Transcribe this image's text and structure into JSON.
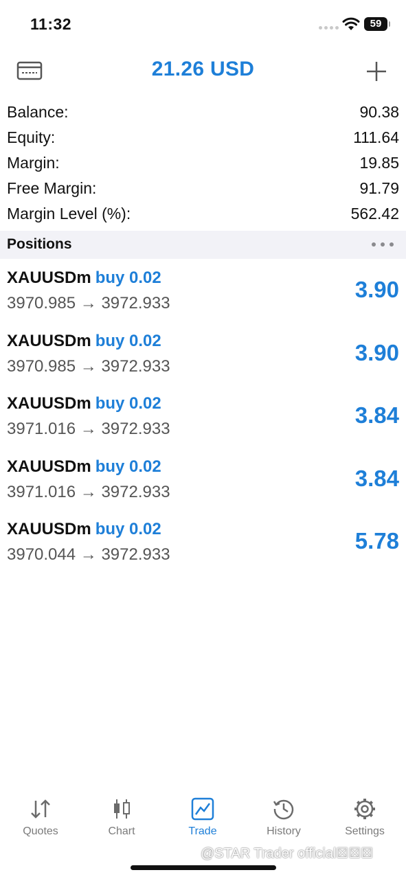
{
  "status": {
    "time": "11:32",
    "battery": "59"
  },
  "header": {
    "title": "21.26 USD"
  },
  "summary": [
    {
      "label": "Balance:",
      "value": "90.38"
    },
    {
      "label": "Equity:",
      "value": "111.64"
    },
    {
      "label": "Margin:",
      "value": "19.85"
    },
    {
      "label": "Free Margin:",
      "value": "91.79"
    },
    {
      "label": "Margin Level (%):",
      "value": "562.42"
    }
  ],
  "positions_header": {
    "title": "Positions"
  },
  "positions": [
    {
      "symbol": "XAUUSDm",
      "side": "buy 0.02",
      "prices": "3970.985 → 3972.933",
      "profit": "3.90"
    },
    {
      "symbol": "XAUUSDm",
      "side": "buy 0.02",
      "prices": "3970.985 → 3972.933",
      "profit": "3.90"
    },
    {
      "symbol": "XAUUSDm",
      "side": "buy 0.02",
      "prices": "3971.016 → 3972.933",
      "profit": "3.84"
    },
    {
      "symbol": "XAUUSDm",
      "side": "buy 0.02",
      "prices": "3971.016 → 3972.933",
      "profit": "3.84"
    },
    {
      "symbol": "XAUUSDm",
      "side": "buy 0.02",
      "prices": "3970.044 → 3972.933",
      "profit": "5.78"
    }
  ],
  "tabs": [
    {
      "label": "Quotes",
      "icon": "quotes-arrows-icon",
      "active": false
    },
    {
      "label": "Chart",
      "icon": "candlestick-chart-icon",
      "active": false
    },
    {
      "label": "Trade",
      "icon": "trade-chart-icon",
      "active": true
    },
    {
      "label": "History",
      "icon": "history-clock-icon",
      "active": false
    },
    {
      "label": "Settings",
      "icon": "gear-icon",
      "active": false
    }
  ],
  "watermark": "@STAR Trader official☒☒☒",
  "colors": {
    "accent": "#1e7fd8",
    "header_bg": "#f2f2f7",
    "inactive": "#7a7a7a"
  }
}
